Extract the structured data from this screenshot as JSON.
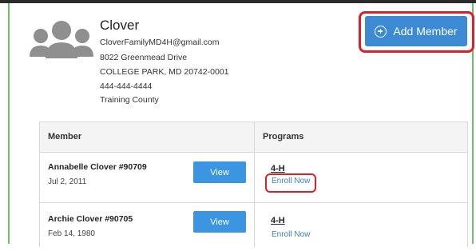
{
  "family": {
    "name": "Clover",
    "email": "CloverFamilyMD4H@gmail.com",
    "address_line1": "8022 Greenmead Drive",
    "address_line2": "COLLEGE PARK, MD 20742-0001",
    "phone": "444-444-4444",
    "county": "Training County"
  },
  "actions": {
    "add_member_label": "Add Member"
  },
  "table": {
    "headers": {
      "member": "Member",
      "programs": "Programs"
    },
    "rows": [
      {
        "name": "Annabelle Clover #90709",
        "date": "Jul 2, 2011",
        "view_label": "View",
        "program": "4-H",
        "enroll_label": "Enroll Now"
      },
      {
        "name": "Archie Clover #90705",
        "date": "Feb 14, 1980",
        "view_label": "View",
        "program": "4-H",
        "enroll_label": "Enroll Now"
      }
    ]
  },
  "colors": {
    "accent_blue": "#3b8ad3",
    "card_border_green": "#6cc16c",
    "highlight_red": "#d8212b",
    "link_blue": "#3b7fc4"
  },
  "icons": {
    "avatar": "people-group-icon",
    "add": "plus-circle-icon"
  }
}
